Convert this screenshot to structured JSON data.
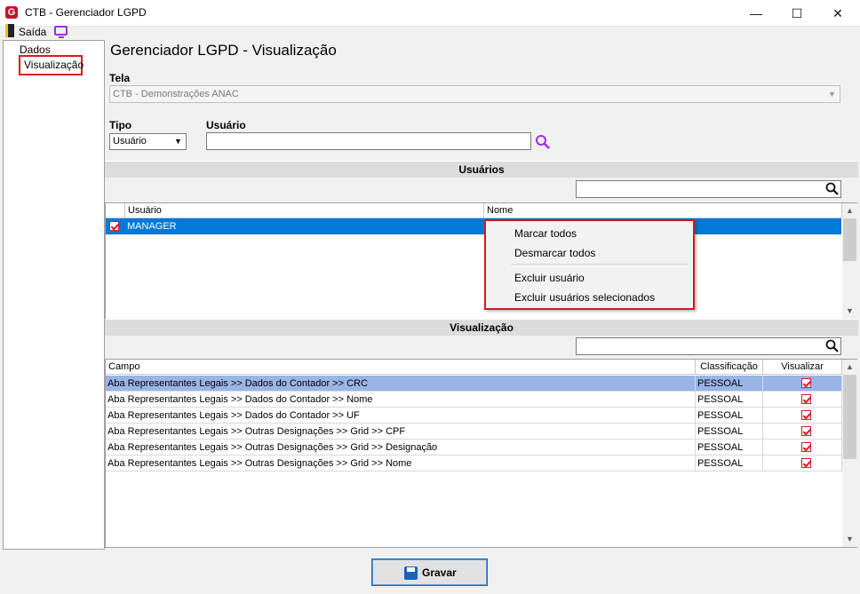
{
  "window": {
    "title": "CTB - Gerenciador LGPD",
    "logo_letter": "G",
    "minimize_glyph": "—",
    "maximize_glyph": "☐",
    "close_glyph": "✕"
  },
  "toolbar": {
    "exit_label": "Saída"
  },
  "nav": {
    "items": [
      "Dados",
      "Visualização"
    ],
    "selected": "Visualização"
  },
  "page": {
    "title": "Gerenciador LGPD - Visualização",
    "tela_label": "Tela",
    "tela_value": "CTB - Demonstrações ANAC",
    "tipo_label": "Tipo",
    "tipo_value": "Usuário",
    "usuario_label": "Usuário",
    "usuario_value": ""
  },
  "users_section": {
    "header": "Usuários",
    "columns": [
      "Usuário",
      "Nome"
    ],
    "rows": [
      {
        "checked": true,
        "usuario": "MANAGER",
        "nome": ""
      }
    ]
  },
  "context_menu": {
    "items": [
      "Marcar todos",
      "Desmarcar todos",
      "Excluir usuário",
      "Excluir usuários selecionados"
    ]
  },
  "visual_section": {
    "header": "Visualização",
    "columns": [
      "Campo",
      "Classificação",
      "Visualizar"
    ],
    "rows": [
      {
        "campo": "Aba Representantes Legais  >> Dados do Contador >>  CRC",
        "classificacao": "PESSOAL",
        "visualizar": true
      },
      {
        "campo": "Aba Representantes Legais  >> Dados do Contador >>  Nome",
        "classificacao": "PESSOAL",
        "visualizar": true
      },
      {
        "campo": "Aba Representantes Legais  >> Dados do Contador >> UF",
        "classificacao": "PESSOAL",
        "visualizar": true
      },
      {
        "campo": "Aba Representantes Legais  >> Outras Designações >> Grid >> CPF",
        "classificacao": "PESSOAL",
        "visualizar": true
      },
      {
        "campo": "Aba Representantes Legais  >> Outras Designações >> Grid >> Designação",
        "classificacao": "PESSOAL",
        "visualizar": true
      },
      {
        "campo": "Aba Representantes Legais  >> Outras Designações >> Grid >> Nome",
        "classificacao": "PESSOAL",
        "visualizar": true
      }
    ]
  },
  "footer": {
    "save_label": "Gravar"
  },
  "colors": {
    "selected_row_users": "#0078d7",
    "selected_row_visual": "#99b4e6",
    "highlight_border": "#e0161d",
    "search_icon": "#9b30d9"
  }
}
